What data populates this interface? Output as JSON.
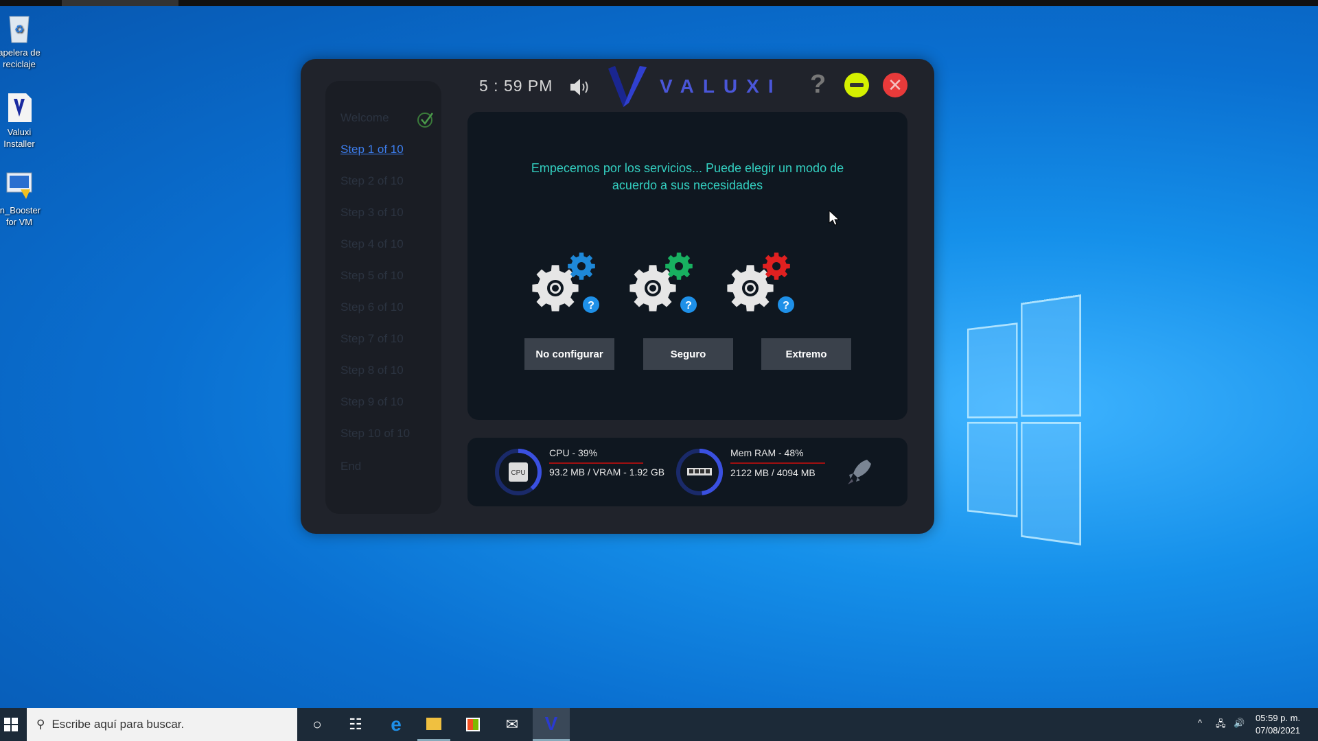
{
  "desktop": {
    "icons": [
      {
        "label_line1": "apelera de",
        "label_line2": "reciclaje"
      },
      {
        "label_line1": "Valuxi",
        "label_line2": "Installer"
      },
      {
        "label_line1": "in_Booster",
        "label_line2": "for VM"
      }
    ]
  },
  "app": {
    "time": "5 : 59 PM",
    "brand": "VALUXI",
    "help_label": "?",
    "sidebar": [
      "Welcome",
      "Step 1 of 10",
      "Step 2 of 10",
      "Step 3 of 10",
      "Step 4 of 10",
      "Step 5 of 10",
      "Step 6 of 10",
      "Step 7 of 10",
      "Step 8 of 10",
      "Step 9 of 10",
      "Step 10 of 10",
      "End"
    ],
    "prompt_line1": "Empecemos por los servicios... Puede elegir un modo de",
    "prompt_line2": "acuerdo a sus necesidades",
    "modes": [
      {
        "label": "No configurar",
        "color": "#1e88d8"
      },
      {
        "label": "Seguro",
        "color": "#18b060"
      },
      {
        "label": "Extremo",
        "color": "#e02020"
      }
    ],
    "stats": {
      "cpu_title": "CPU - 39%",
      "cpu_detail": "93.2 MB / VRAM - 1.92 GB",
      "cpu_percent": 39,
      "cpu_chip": "CPU",
      "ram_title": "Mem RAM - 48%",
      "ram_detail": "2122 MB / 4094 MB",
      "ram_percent": 48
    }
  },
  "taskbar": {
    "search_placeholder": "Escribe aquí para buscar.",
    "clock_time": "05:59 p. m.",
    "clock_date": "07/08/2021"
  }
}
